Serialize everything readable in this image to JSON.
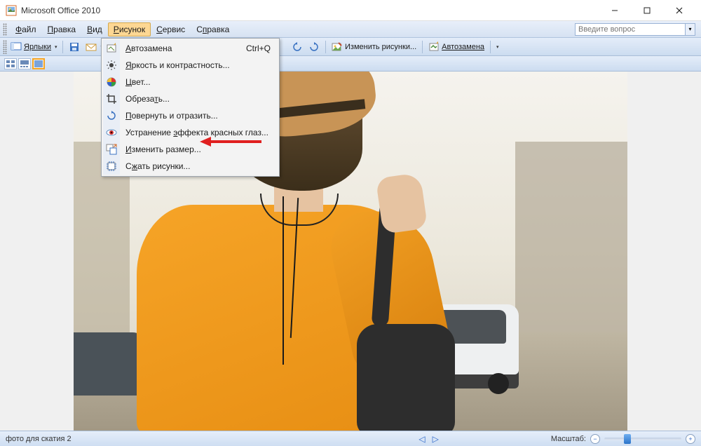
{
  "title": "Microsoft Office 2010",
  "menubar": {
    "items": [
      {
        "label": "Файл",
        "u": 0
      },
      {
        "label": "Правка",
        "u": 0
      },
      {
        "label": "Вид",
        "u": 0
      },
      {
        "label": "Рисунок",
        "u": 0,
        "active": true
      },
      {
        "label": "Сервис",
        "u": 0
      },
      {
        "label": "Справка",
        "u": 1
      }
    ],
    "help_placeholder": "Введите вопрос"
  },
  "toolbar": {
    "shortcuts_label": "Ярлыки",
    "edit_pics_label": "Изменить рисунки...",
    "autocorrect_label": "Автозамена"
  },
  "dropdown": {
    "items": [
      {
        "icon": "autoreplace",
        "label": "Автозамена",
        "u": 0,
        "shortcut": "Ctrl+Q"
      },
      {
        "icon": "brightness",
        "label": "Яркость и контрастность...",
        "u": 0
      },
      {
        "icon": "color",
        "label": "Цвет...",
        "u": 0
      },
      {
        "icon": "crop",
        "label": "Обрезать...",
        "u": 6
      },
      {
        "icon": "rotate",
        "label": "Повернуть и отразить...",
        "u": 0
      },
      {
        "icon": "redeye",
        "label": "Устранение эффекта красных глаз...",
        "u": 11
      },
      {
        "icon": "resize",
        "label": "Изменить размер...",
        "u": 0
      },
      {
        "icon": "compress",
        "label": "Сжать рисунки...",
        "u": 1
      }
    ]
  },
  "statusbar": {
    "filename": "фото для скатия 2",
    "zoom_label": "Масштаб:"
  }
}
